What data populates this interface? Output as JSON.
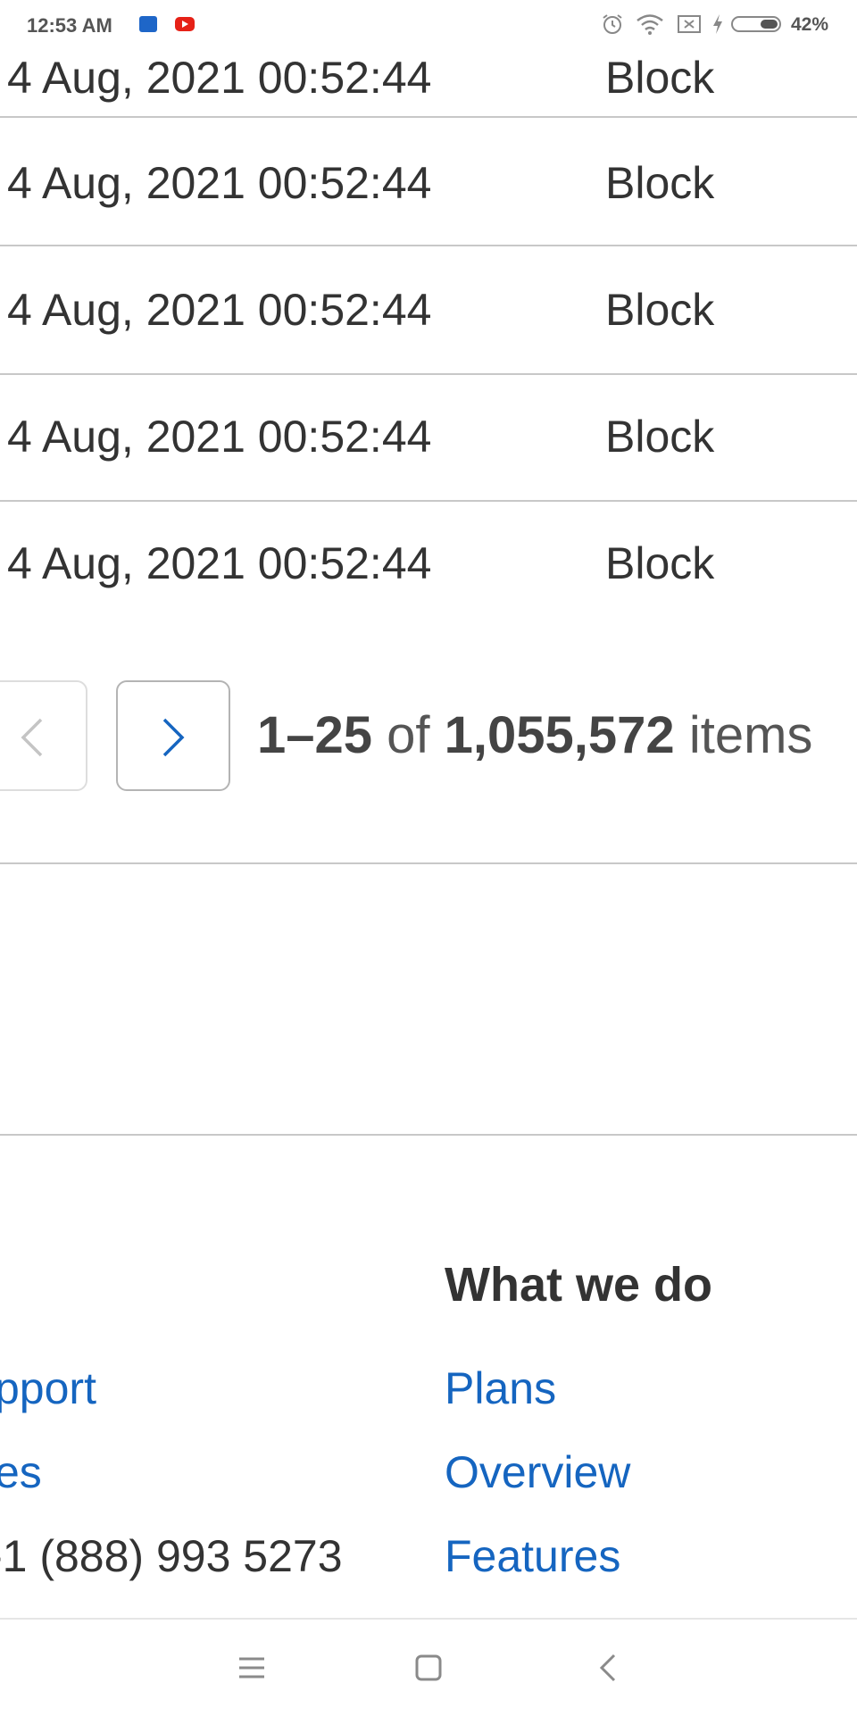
{
  "status_bar": {
    "time": "12:53 AM",
    "battery": "42%",
    "icons": [
      "outlook-icon",
      "youtube-icon",
      "alarm-icon",
      "wifi-icon",
      "sim-icon",
      "charging-icon",
      "battery-icon"
    ]
  },
  "table": {
    "rows": [
      {
        "date": "4 Aug, 2021 00:52:44",
        "type": "Block"
      },
      {
        "date": "4 Aug, 2021 00:52:44",
        "type": "Block"
      },
      {
        "date": "4 Aug, 2021 00:52:44",
        "type": "Block"
      },
      {
        "date": "4 Aug, 2021 00:52:44",
        "type": "Block"
      },
      {
        "date": "4 Aug, 2021 00:52:44",
        "type": "Block"
      }
    ]
  },
  "pagination": {
    "range": "1–25",
    "of": "of",
    "total": "1,055,572",
    "items_word": "items",
    "prev_icon": "chevron-left-icon",
    "next_icon": "chevron-right-icon"
  },
  "footer": {
    "left_links": [
      "pport",
      "es"
    ],
    "phone": "-1 (888) 993 5273",
    "what_we_do": {
      "heading": "What we do",
      "links": [
        "Plans",
        "Overview",
        "Features"
      ]
    }
  },
  "colors": {
    "link": "#1565c0",
    "text": "#333333",
    "border": "#c8c8c8"
  }
}
